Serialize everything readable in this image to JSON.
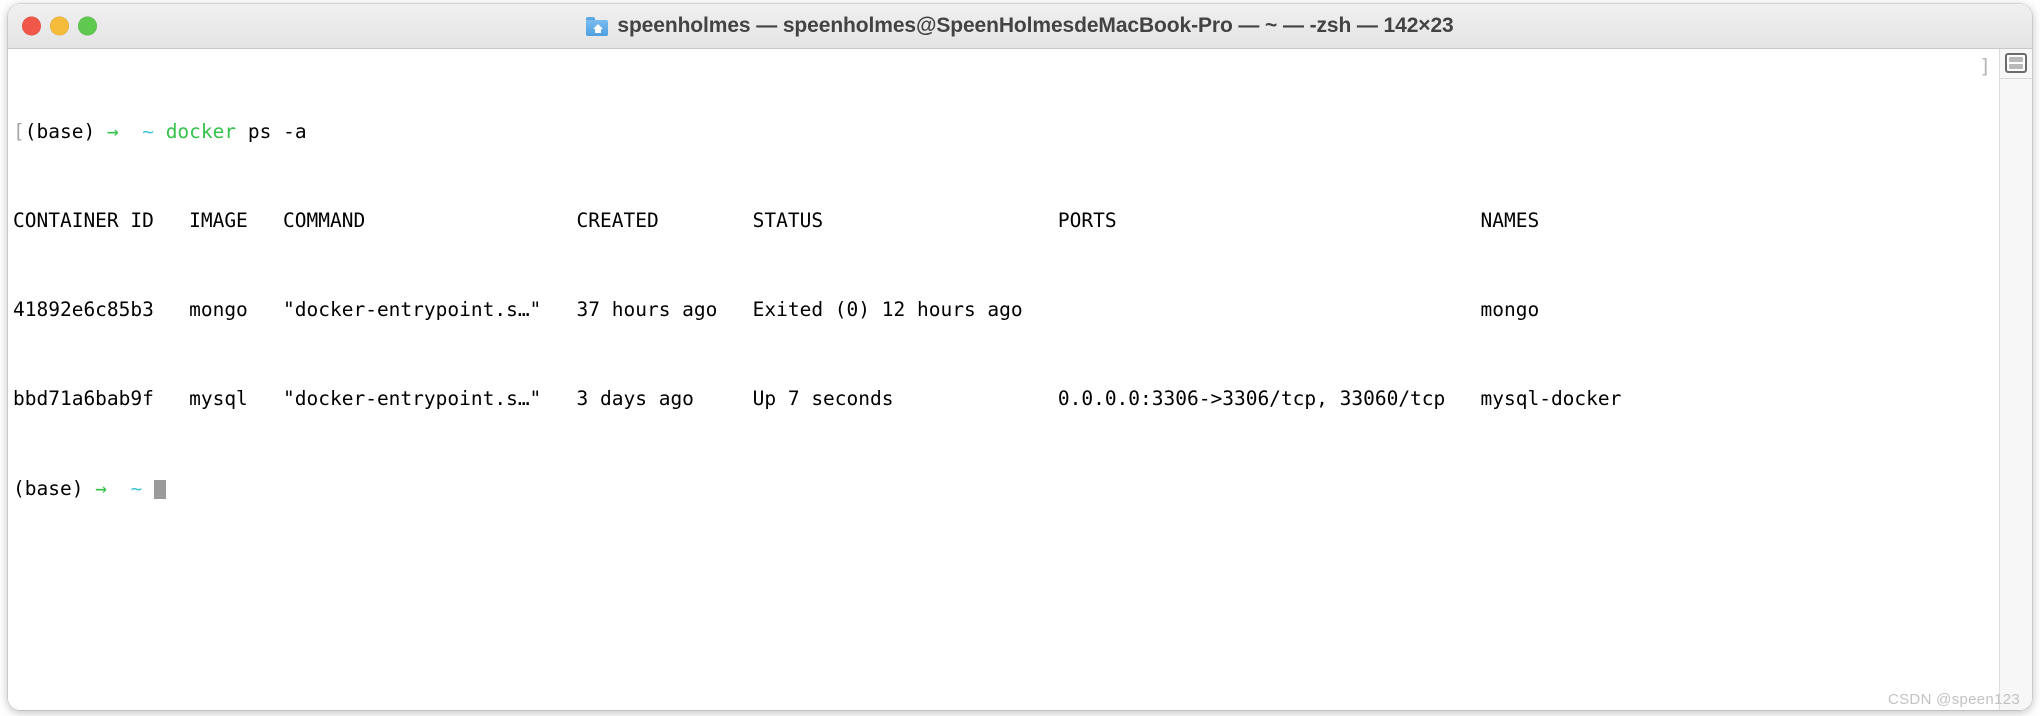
{
  "window": {
    "title": "speenholmes — speenholmes@SpeenHolmesdeMacBook-Pro — ~ — -zsh — 142×23",
    "folder_icon": "folder-home-icon",
    "traffic_lights": {
      "close": "close-button",
      "minimize": "minimize-button",
      "zoom": "zoom-button"
    },
    "colors": {
      "close": "#f2584a",
      "minimize": "#f5bc3c",
      "zoom": "#5fc84f",
      "title_text": "#434343",
      "titlebar_bg": "#e8e8e8"
    }
  },
  "terminal": {
    "colors": {
      "background": "#ffffff",
      "foreground": "#000000",
      "prompt_arrow": "#34c24a",
      "prompt_path": "#46c8d8",
      "command": "#34c24a",
      "cursor": "#9a9a9a",
      "bracket": "#b5b5b5"
    },
    "prompt": {
      "env": "(base)",
      "arrow": "→",
      "path": "~"
    },
    "command_line": {
      "command": "docker",
      "args": " ps -a"
    },
    "trailing_bracket": "]",
    "table": {
      "headers": [
        "CONTAINER ID",
        "IMAGE",
        "COMMAND",
        "CREATED",
        "STATUS",
        "PORTS",
        "NAMES"
      ],
      "header_line": "CONTAINER ID   IMAGE   COMMAND                  CREATED        STATUS                    PORTS                               NAMES",
      "rows": [
        {
          "container_id": "41892e6c85b3",
          "image": "mongo",
          "command": "\"docker-entrypoint.s…\"",
          "created": "37 hours ago",
          "status": "Exited (0) 12 hours ago",
          "ports": "",
          "names": "mongo",
          "line": "41892e6c85b3   mongo   \"docker-entrypoint.s…\"   37 hours ago   Exited (0) 12 hours ago                                       mongo"
        },
        {
          "container_id": "bbd71a6bab9f",
          "image": "mysql",
          "command": "\"docker-entrypoint.s…\"",
          "created": "3 days ago",
          "status": "Up 7 seconds",
          "ports": "0.0.0.0:3306->3306/tcp, 33060/tcp",
          "names": "mysql-docker",
          "line": "bbd71a6bab9f   mysql   \"docker-entrypoint.s…\"   3 days ago     Up 7 seconds              0.0.0.0:3306->3306/tcp, 33060/tcp   mysql-docker"
        }
      ]
    },
    "final_prompt": {
      "env": "(base)",
      "arrow": "→",
      "path": "~"
    }
  },
  "right_rail": {
    "pane_icon": "split-pane-icon"
  },
  "watermark": {
    "text": "CSDN @speen123"
  }
}
